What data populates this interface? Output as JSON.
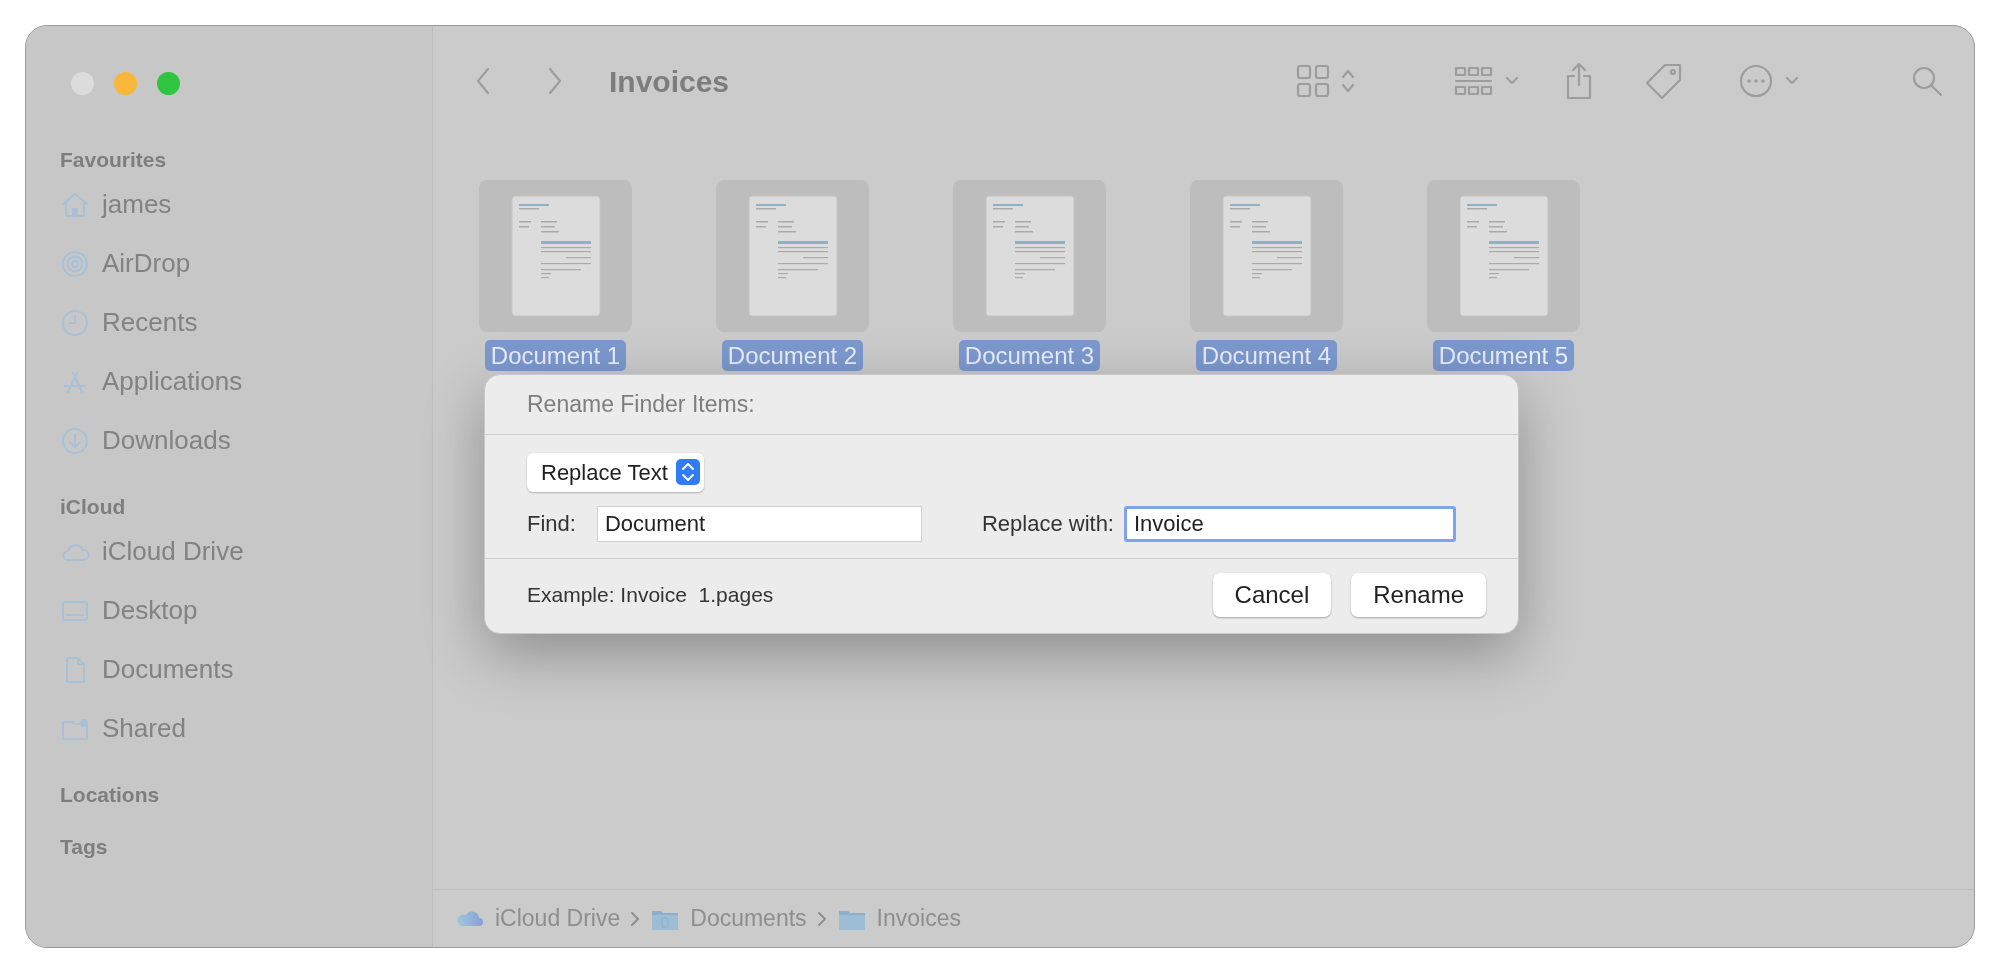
{
  "window": {
    "title": "Invoices"
  },
  "sidebar": [
    {
      "heading": "Favourites",
      "items": [
        {
          "label": "james",
          "kind": "home"
        },
        {
          "label": "AirDrop",
          "kind": "airdrop"
        },
        {
          "label": "Recents",
          "kind": "clock"
        },
        {
          "label": "Applications",
          "kind": "apps"
        },
        {
          "label": "Downloads",
          "kind": "download"
        }
      ]
    },
    {
      "heading": "iCloud",
      "items": [
        {
          "label": "iCloud Drive",
          "kind": "cloud"
        },
        {
          "label": "Desktop",
          "kind": "desktop"
        },
        {
          "label": "Documents",
          "kind": "document"
        },
        {
          "label": "Shared",
          "kind": "shared"
        }
      ]
    },
    {
      "heading": "Locations"
    },
    {
      "heading": "Tags"
    }
  ],
  "files": [
    {
      "name": "Document 1",
      "selected": true
    },
    {
      "name": "Document 2",
      "selected": true
    },
    {
      "name": "Document 3",
      "selected": true
    },
    {
      "name": "Document 4",
      "selected": true
    },
    {
      "name": "Document 5",
      "selected": true
    }
  ],
  "dialog": {
    "title": "Rename Finder Items:",
    "mode": "Replace Text",
    "find_label": "Find:",
    "find_value": "Document",
    "replace_label": "Replace with:",
    "replace_value": "Invoice ",
    "replace_focused": true,
    "example": "Example: Invoice  1.pages",
    "buttons": [
      {
        "label": "Cancel"
      },
      {
        "label": "Rename"
      }
    ]
  },
  "path_bar": [
    {
      "label": "iCloud Drive",
      "kind": "cloud"
    },
    {
      "label": "Documents",
      "kind": "documents-folder"
    },
    {
      "label": "Invoices",
      "kind": "folder"
    }
  ]
}
